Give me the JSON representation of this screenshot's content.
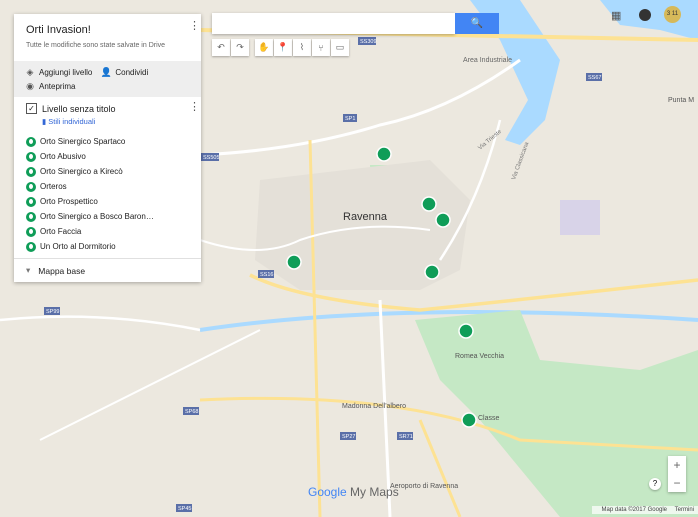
{
  "map": {
    "labels": [
      {
        "text": "Ravenna"
      },
      {
        "text": "Area Industriale"
      },
      {
        "text": "Romea Vecchia"
      },
      {
        "text": "Madonna Dell'albero"
      },
      {
        "text": "Aeroporto di Ravenna"
      },
      {
        "text": "Classe"
      },
      {
        "text": "Punta M"
      },
      {
        "text": "Via Trieste"
      },
      {
        "text": "Via Classicana"
      },
      {
        "text": "SS309"
      },
      {
        "text": "SS16"
      },
      {
        "text": "SS67"
      },
      {
        "text": "SP1"
      },
      {
        "text": "SP99"
      },
      {
        "text": "SP68"
      },
      {
        "text": "SP27"
      },
      {
        "text": "SR71"
      },
      {
        "text": "SP45"
      },
      {
        "text": "SS505"
      }
    ],
    "colors": {
      "land": "#ece8df",
      "water": "#aadaff",
      "park": "#c5e8c5",
      "road": "#ffffff",
      "highway": "#fde293",
      "marker": "#0f9d58"
    }
  },
  "panel": {
    "title": "Orti Invasion!",
    "saved": "Tutte le modifiche sono state salvate in Drive",
    "add_layer": "Aggiungi livello",
    "share": "Condividi",
    "preview": "Anteprima",
    "layer_name": "Livello senza titolo",
    "styles": "Stili individuali",
    "items": [
      "Orto Sinergico Spartaco",
      "Orto Abusivo",
      "Orto Sinergico a Kirecò",
      "Orteros",
      "Orto Prospettico",
      "Orto Sinergico a Bosco Baron…",
      "Orto Faccia",
      "Un Orto al Dormitorio"
    ],
    "base_map": "Mappa base"
  },
  "search": {
    "placeholder": ""
  },
  "avatar_text": "3 11",
  "bell_text": "",
  "zoom": {
    "in": "+",
    "out": "−"
  },
  "help": "?",
  "logo": {
    "brand": "Google",
    "product": "My Maps"
  },
  "attribution": {
    "data": "Map data ©2017 Google",
    "terms": "Termini"
  }
}
